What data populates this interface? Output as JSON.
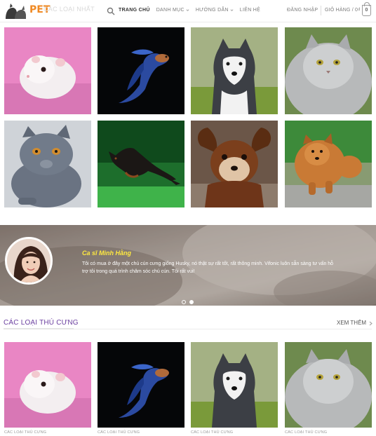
{
  "header": {
    "logo_text": "PET",
    "ghost_heading": "CÁC LOẠI NHẤT",
    "nav": [
      {
        "label": "TRANG CHỦ",
        "active": true,
        "dropdown": false
      },
      {
        "label": "DANH MỤC",
        "active": false,
        "dropdown": true
      },
      {
        "label": "HƯỚNG DẪN",
        "active": false,
        "dropdown": true
      },
      {
        "label": "LIÊN HỆ",
        "active": false,
        "dropdown": false
      }
    ],
    "login": "ĐĂNG NHẬP",
    "cart_label": "GIỎ HÀNG / 0₫",
    "cart_count": "0"
  },
  "gallery": [
    {
      "name": "hamster"
    },
    {
      "name": "betta-fish"
    },
    {
      "name": "husky"
    },
    {
      "name": "persian-cat"
    },
    {
      "name": "british-shorthair"
    },
    {
      "name": "doberman-puppy"
    },
    {
      "name": "chihuahua"
    },
    {
      "name": "pomeranian"
    }
  ],
  "testimonial": {
    "name": "Ca sĩ Minh Hằng",
    "quote": "Tôi có mua ở đây một chú cún cưng giống Husky, nó thật sự rất tốt, rất thông minh. Vifonic luôn sẵn sàng tư vấn hỗ trợ tôi trong quá trình chăm sóc chú cún. Tôi rất vui!",
    "slides": 2,
    "active_slide": 2
  },
  "section": {
    "title": "CÁC LOẠI THÚ CƯNG",
    "see_more": "XEM THÊM",
    "cards": [
      {
        "category": "CÁC LOẠI THÚ CƯNG"
      },
      {
        "category": "CÁC LOẠI THÚ CƯNG"
      },
      {
        "category": "CÁC LOẠI THÚ CƯNG"
      },
      {
        "category": "CÁC LOẠI THÚ CƯNG"
      }
    ]
  },
  "colors": {
    "accent_purple": "#6b3fa0",
    "logo_orange": "#f08a24",
    "name_yellow": "#ffe940"
  }
}
